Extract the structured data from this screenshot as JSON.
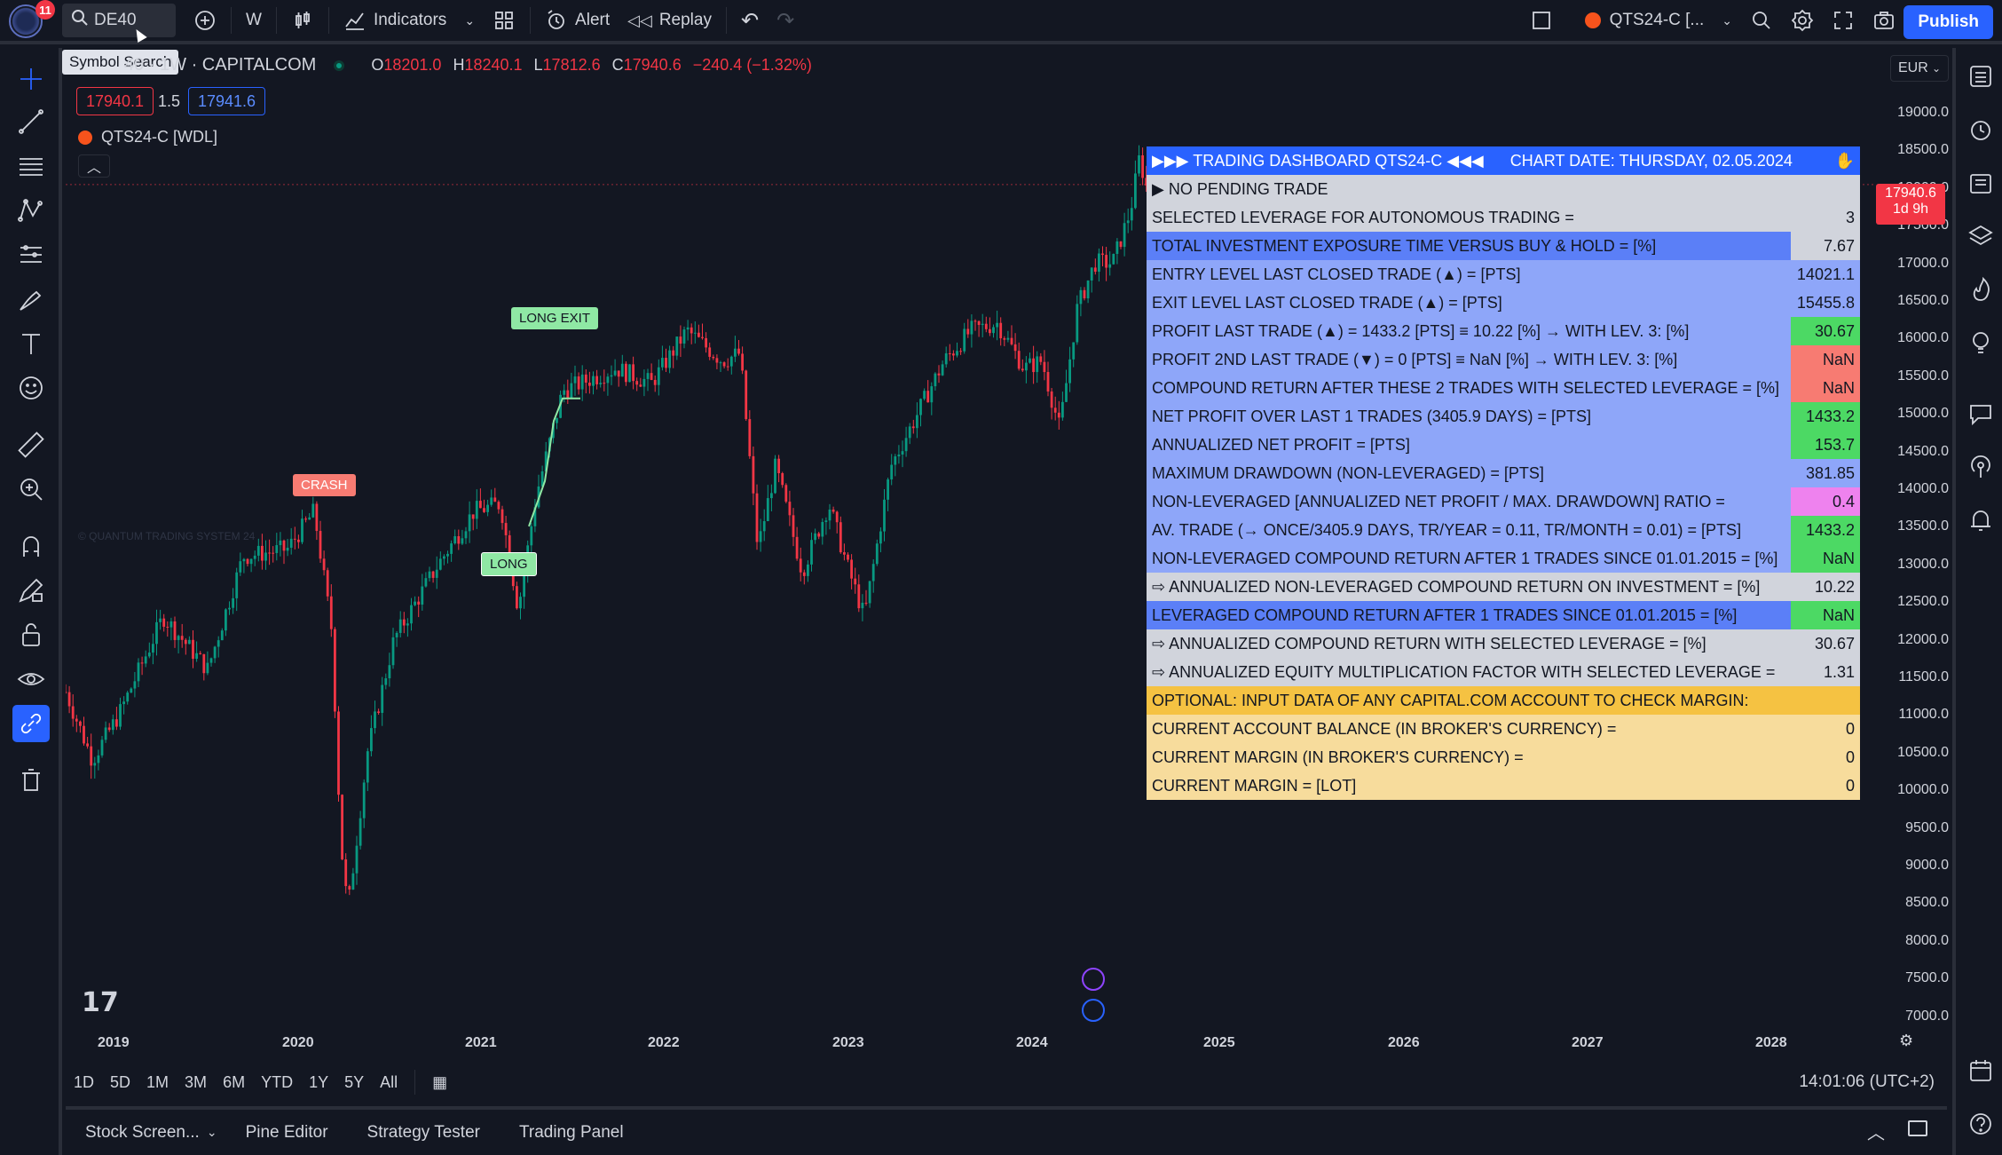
{
  "topbar": {
    "notification_count": "11",
    "symbol": "DE40",
    "interval": "W",
    "indicators": "Indicators",
    "alert": "Alert",
    "replay": "Replay",
    "strategy_name": "QTS24-C [...",
    "publish": "Publish"
  },
  "tooltip": "Symbol Search",
  "legend": {
    "title": "40 · 1W · CAPITALCOM",
    "o_label": "O",
    "o": "18201.0",
    "h_label": "H",
    "h": "18240.1",
    "l_label": "L",
    "l": "17812.6",
    "c_label": "C",
    "c": "17940.6",
    "change": "−240.4 (−1.32%)",
    "bid": "17940.1",
    "spread": "1.5",
    "ask": "17941.6",
    "indicator": "QTS24-C [WDL]"
  },
  "currency": "EUR",
  "price_axis": [
    "19000.0",
    "18500.0",
    "18000.0",
    "17500.0",
    "17000.0",
    "16500.0",
    "16000.0",
    "15500.0",
    "15000.0",
    "14500.0",
    "14000.0",
    "13500.0",
    "13000.0",
    "12500.0",
    "12000.0",
    "11500.0",
    "11000.0",
    "10500.0",
    "10000.0",
    "9500.0",
    "9000.0",
    "8500.0",
    "8000.0",
    "7500.0",
    "7000.0"
  ],
  "current_price": {
    "value": "17940.6",
    "countdown": "1d 9h"
  },
  "time_axis": [
    "2019",
    "2020",
    "2021",
    "2022",
    "2023",
    "2024",
    "2025",
    "2026",
    "2027",
    "2028"
  ],
  "markers": {
    "crash": "CRASH",
    "long": "LONG",
    "long_exit": "LONG EXIT"
  },
  "watermark": "© QUANTUM TRADING SYSTEM 24",
  "dashboard": {
    "header": "▶▶▶ TRADING DASHBOARD QTS24-C ◀◀◀",
    "chart_date": "CHART DATE:  THURSDAY, 02.05.2024",
    "rows": [
      {
        "label": "▶ NO PENDING TRADE",
        "value": "",
        "bg": "#d1d4dc",
        "vbg": "#d1d4dc"
      },
      {
        "label": "SELECTED LEVERAGE FOR AUTONOMOUS TRADING =",
        "value": "3",
        "bg": "#d1d4dc",
        "vbg": "#d1d4dc"
      },
      {
        "label": "TOTAL INVESTMENT EXPOSURE TIME VERSUS BUY & HOLD = [%]",
        "value": "7.67",
        "bg": "#5b7ff7",
        "vbg": "#d1d4dc"
      },
      {
        "label": "ENTRY LEVEL LAST CLOSED TRADE (▲) = [PTS]",
        "value": "14021.1",
        "bg": "#8ea6f9",
        "vbg": "#8ea6f9"
      },
      {
        "label": "EXIT LEVEL LAST CLOSED TRADE (▲) = [PTS]",
        "value": "15455.8",
        "bg": "#8ea6f9",
        "vbg": "#8ea6f9"
      },
      {
        "label": "PROFIT LAST TRADE (▲) = 1433.2 [PTS] ≡ 10.22 [%] → WITH LEV. 3: [%]",
        "value": "30.67",
        "bg": "#8ea6f9",
        "vbg": "#4cd964"
      },
      {
        "label": "PROFIT 2ND LAST TRADE (▼) = 0 [PTS] ≡ NaN [%] → WITH LEV. 3: [%]",
        "value": "NaN",
        "bg": "#8ea6f9",
        "vbg": "#f77b72"
      },
      {
        "label": "COMPOUND RETURN AFTER THESE 2 TRADES WITH SELECTED LEVERAGE = [%]",
        "value": "NaN",
        "bg": "#8ea6f9",
        "vbg": "#f77b72"
      },
      {
        "label": "NET PROFIT OVER LAST 1 TRADES (3405.9 DAYS) = [PTS]",
        "value": "1433.2",
        "bg": "#8ea6f9",
        "vbg": "#4cd964"
      },
      {
        "label": "ANNUALIZED NET PROFIT = [PTS]",
        "value": "153.7",
        "bg": "#8ea6f9",
        "vbg": "#4cd964"
      },
      {
        "label": "MAXIMUM DRAWDOWN (NON-LEVERAGED) = [PTS]",
        "value": "381.85",
        "bg": "#8ea6f9",
        "vbg": "#8ea6f9"
      },
      {
        "label": "NON-LEVERAGED [ANNUALIZED NET PROFIT / MAX. DRAWDOWN] RATIO =",
        "value": "0.4",
        "bg": "#8ea6f9",
        "vbg": "#ee82ee"
      },
      {
        "label": "AV. TRADE (→ ONCE/3405.9 DAYS, TR/YEAR = 0.11, TR/MONTH = 0.01) = [PTS]",
        "value": "1433.2",
        "bg": "#8ea6f9",
        "vbg": "#4cd964"
      },
      {
        "label": "NON-LEVERAGED COMPOUND RETURN AFTER 1 TRADES SINCE 01.01.2015 = [%]",
        "value": "NaN",
        "bg": "#8ea6f9",
        "vbg": "#4cd964"
      },
      {
        "label": "⇨ ANNUALIZED NON-LEVERAGED COMPOUND RETURN ON INVESTMENT = [%]",
        "value": "10.22",
        "bg": "#d1d4dc",
        "vbg": "#d1d4dc"
      },
      {
        "label": "LEVERAGED COMPOUND RETURN AFTER 1 TRADES SINCE 01.01.2015 = [%]",
        "value": "NaN",
        "bg": "#5b7ff7",
        "vbg": "#4cd964"
      },
      {
        "label": "⇨ ANNUALIZED COMPOUND RETURN WITH SELECTED LEVERAGE = [%]",
        "value": "30.67",
        "bg": "#d1d4dc",
        "vbg": "#d1d4dc"
      },
      {
        "label": "⇨ ANNUALIZED EQUITY MULTIPLICATION FACTOR WITH SELECTED LEVERAGE =",
        "value": "1.31",
        "bg": "#d1d4dc",
        "vbg": "#d1d4dc"
      },
      {
        "label": "OPTIONAL: INPUT DATA OF ANY CAPITAL.COM ACCOUNT TO CHECK MARGIN:",
        "value": "",
        "bg": "#f5c242",
        "vbg": "#f5c242"
      },
      {
        "label": "CURRENT ACCOUNT BALANCE (IN BROKER'S CURRENCY) =",
        "value": "0",
        "bg": "#f7dc9c",
        "vbg": "#f7dc9c"
      },
      {
        "label": "CURRENT MARGIN (IN BROKER'S CURRENCY) =",
        "value": "0",
        "bg": "#f7dc9c",
        "vbg": "#f7dc9c"
      },
      {
        "label": "CURRENT MARGIN = [LOT]",
        "value": "0",
        "bg": "#f7dc9c",
        "vbg": "#f7dc9c"
      }
    ]
  },
  "range_buttons": [
    "1D",
    "5D",
    "1M",
    "3M",
    "6M",
    "YTD",
    "1Y",
    "5Y",
    "All"
  ],
  "clock": "14:01:06 (UTC+2)",
  "bottom_tabs": [
    "Stock Screen...",
    "Pine Editor",
    "Strategy Tester",
    "Trading Panel"
  ],
  "colors": {
    "up": "#089981",
    "down": "#f23645",
    "accent": "#2962ff"
  }
}
